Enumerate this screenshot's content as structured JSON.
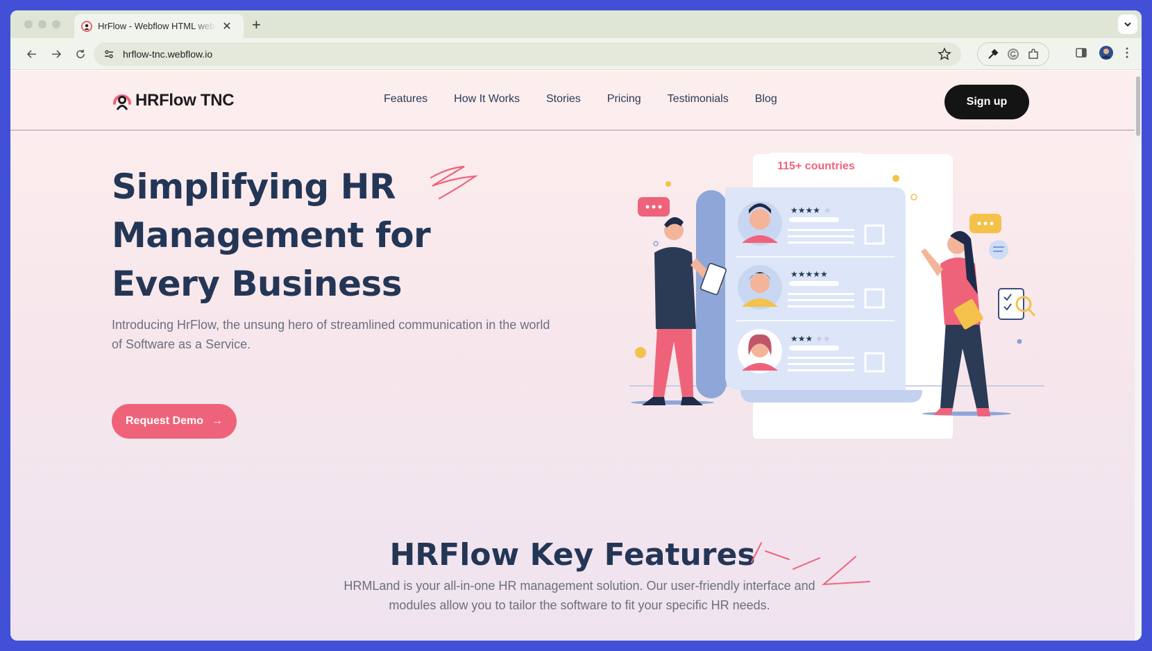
{
  "browser": {
    "tab_title": "HrFlow - Webflow HTML website template",
    "url": "hrflow-tnc.webflow.io",
    "new_tab_label": "+",
    "close_label": "✕"
  },
  "site": {
    "logo_text": "HRFlow TNC",
    "nav": [
      "Features",
      "How It Works",
      "Stories",
      "Pricing",
      "Testimonials",
      "Blog"
    ],
    "signup_label": "Sign up"
  },
  "hero": {
    "title": "Simplifying HR Management for Every Business",
    "subtitle": "Introducing HrFlow, the unsung hero of streamlined communication in the world of Software as a Service.",
    "cta_label": "Request Demo",
    "cta_arrow": "→",
    "badge": "115+ countries"
  },
  "features": {
    "title": "HRFlow Key Features",
    "subtitle": "HRMLand is your all-in-one HR management solution. Our user-friendly interface and modules allow you to tailor the software to fit your specific HR needs."
  },
  "colors": {
    "accent": "#ef637a",
    "heading": "#243656",
    "frame": "#4150d6"
  }
}
